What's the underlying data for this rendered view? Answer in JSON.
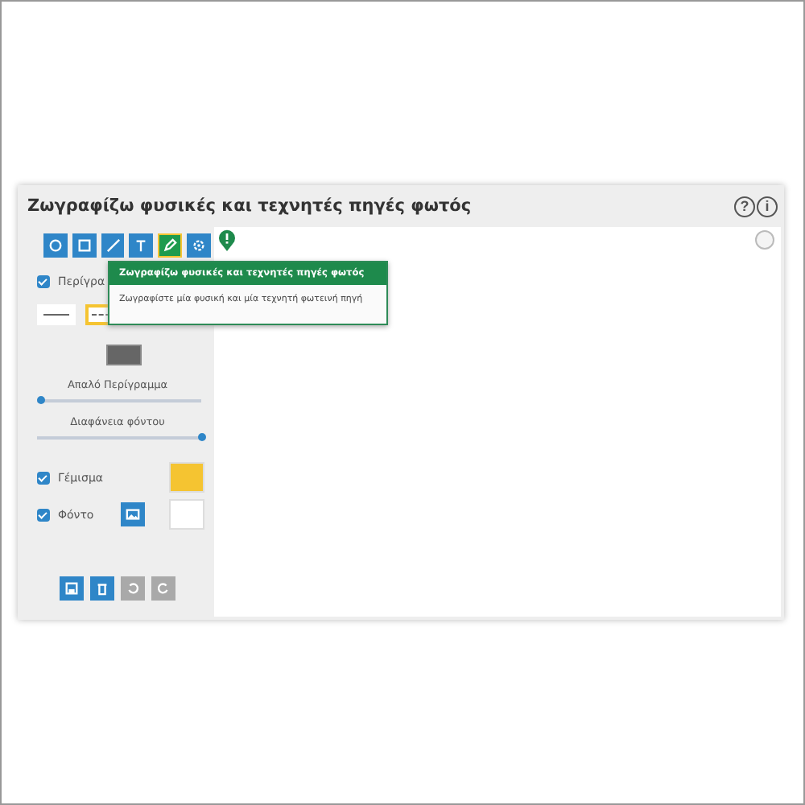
{
  "panel": {
    "title": "Ζωγραφίζω φυσικές και τεχνητές πηγές φωτός",
    "help": "?",
    "info": "i"
  },
  "tools": [
    {
      "kind": "circle",
      "selected": false
    },
    {
      "kind": "square",
      "selected": false
    },
    {
      "kind": "line",
      "selected": false
    },
    {
      "kind": "text",
      "selected": false
    },
    {
      "kind": "pencil",
      "selected": true
    },
    {
      "kind": "gear",
      "selected": false
    }
  ],
  "outline": {
    "label": "Περίγρα",
    "checked": true
  },
  "line_styles": [
    {
      "kind": "solid",
      "selected": false
    },
    {
      "kind": "dashed",
      "selected": true
    }
  ],
  "sliders": [
    {
      "label": "Απαλό Περίγραμμα",
      "level": 0.02
    },
    {
      "label": "Διαφάνεια φόντου",
      "level": 1
    }
  ],
  "fill": {
    "label": "Γέμισμα",
    "checked": true,
    "color": "#f5c431"
  },
  "background": {
    "label": "Φόντο",
    "checked": true,
    "color": "#ffffff"
  },
  "actions": [
    {
      "kind": "save",
      "disabled": false
    },
    {
      "kind": "delete",
      "disabled": false
    },
    {
      "kind": "undo",
      "disabled": true
    },
    {
      "kind": "redo",
      "disabled": true
    }
  ],
  "tooltip": {
    "title": "Ζωγραφίζω φυσικές και τεχνητές πηγές φωτός",
    "text": "Ζωγραφίστε μία φυσική και μία τεχνητή φωτεινή πηγή"
  }
}
